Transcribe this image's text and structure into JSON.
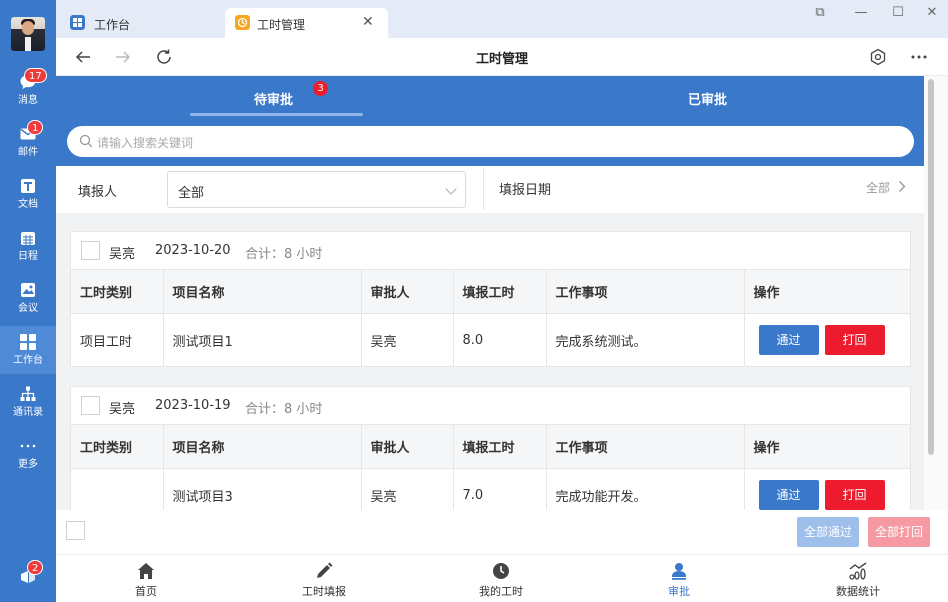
{
  "sidebar": {
    "items": [
      {
        "label": "消息",
        "badge": "17",
        "icon": "chat-bubble-icon"
      },
      {
        "label": "邮件",
        "badge": "1",
        "icon": "mail-icon"
      },
      {
        "label": "文档",
        "icon": "document-icon"
      },
      {
        "label": "日程",
        "icon": "calendar-icon"
      },
      {
        "label": "会议",
        "icon": "meeting-icon"
      },
      {
        "label": "工作台",
        "icon": "workbench-grid-icon",
        "active": true
      },
      {
        "label": "通讯录",
        "icon": "org-chart-icon"
      },
      {
        "label": "更多",
        "icon": "more-dots-icon"
      }
    ],
    "bottom_badge": "2"
  },
  "tabs": [
    {
      "label": "工作台",
      "icon": "workbench-grid-icon"
    },
    {
      "label": "工时管理",
      "icon": "timesheet-app-icon",
      "active": true
    }
  ],
  "navbar": {
    "title": "工时管理"
  },
  "header": {
    "tabs": [
      {
        "label": "待审批",
        "badge": "3",
        "active": true
      },
      {
        "label": "已审批"
      }
    ],
    "search_placeholder": "请输入搜索关键词"
  },
  "filter": {
    "reporter_label": "填报人",
    "reporter_value": "全部",
    "date_label": "填报日期",
    "date_value": "全部"
  },
  "table_headers": [
    "工时类别",
    "项目名称",
    "审批人",
    "填报工时",
    "工作事项",
    "操作"
  ],
  "cards": [
    {
      "name": "吴亮",
      "date": "2023-10-20",
      "summary": "合计：8 小时",
      "rows": [
        {
          "category": "项目工时",
          "project": "测试项目1",
          "approver": "吴亮",
          "hours": "8.0",
          "item": "完成系统测试。"
        }
      ]
    },
    {
      "name": "吴亮",
      "date": "2023-10-19",
      "summary": "合计：8 小时",
      "rows": [
        {
          "category": "",
          "project": "测试项目3",
          "approver": "吴亮",
          "hours": "7.0",
          "item": "完成功能开发。"
        }
      ]
    }
  ],
  "actions": {
    "pass": "通过",
    "reject": "打回",
    "pass_all": "全部通过",
    "reject_all": "全部打回"
  },
  "bottom_nav": [
    {
      "label": "首页",
      "icon": "home-icon"
    },
    {
      "label": "工时填报",
      "icon": "pencil-icon"
    },
    {
      "label": "我的工时",
      "icon": "clock-icon"
    },
    {
      "label": "审批",
      "icon": "user-approval-icon",
      "active": true
    },
    {
      "label": "数据统计",
      "icon": "stats-chart-icon"
    }
  ],
  "colors": {
    "primary": "#3a78c9",
    "danger": "#ec1c2e",
    "badge": "#ee3b3b"
  }
}
